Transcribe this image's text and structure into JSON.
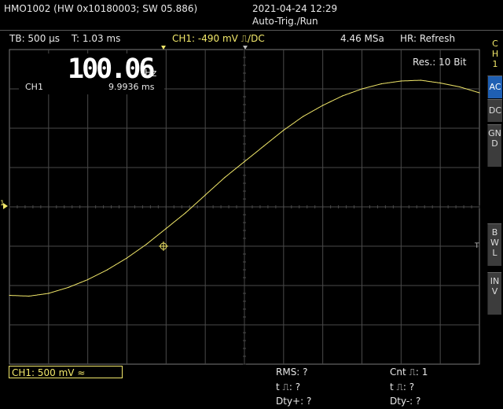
{
  "header": {
    "device": "HMO1002 (HW 0x10180003; SW 05.886)",
    "datetime": "2021-04-24 12:29",
    "mode": "Auto-Trig./Run"
  },
  "status_bar": {
    "timebase": "TB: 500 µs",
    "trigger_time": "T: 1.03 ms",
    "trigger_info": "CH1: -490 mV ⎍/DC",
    "sample_rate": "4.46 MSa",
    "hr": "HR: Refresh"
  },
  "overlay": {
    "resolution": "Res.: 10 Bit",
    "freq_value": "100.06",
    "freq_unit": "Hz",
    "channel": "CH1",
    "period": "9.9936 ms"
  },
  "side": {
    "channel_tag": [
      "C",
      "H",
      "1"
    ],
    "buttons": [
      {
        "label": "AC",
        "active": true
      },
      {
        "label": "DC",
        "active": false
      },
      {
        "label": "GND",
        "active": false
      },
      {
        "label": "BWL",
        "active": false
      },
      {
        "label": "INV",
        "active": false
      }
    ]
  },
  "markers": {
    "left": "1",
    "right": "T"
  },
  "bottom": {
    "ch1_setting": "CH1: 500 mV ≈",
    "rms": "RMS: ?",
    "pos_width": "t ⎍: ?",
    "pos_duty": "Dty+: ?",
    "count": "Cnt ⎍: 1",
    "neg_width": "t ⎍: ?",
    "neg_duty": "Dty-: ?"
  },
  "colors": {
    "trace": "#f2e86a",
    "grid": "#4a4a4a",
    "accent": "#1f5fb3"
  },
  "chart_data": {
    "type": "line",
    "x_divisions": 12,
    "y_divisions": 8,
    "series": [
      {
        "x": [
          0,
          0.5,
          1.0,
          1.5,
          2.0,
          2.5,
          3.0,
          3.5,
          4.0,
          4.5,
          5.0,
          5.5,
          6.0,
          6.5,
          7.0,
          7.5,
          8.0,
          8.5,
          9.0,
          9.5,
          10.0,
          10.5,
          11.0,
          11.5,
          12.0
        ],
        "y": [
          -2.25,
          -2.27,
          -2.2,
          -2.05,
          -1.85,
          -1.6,
          -1.3,
          -0.95,
          -0.55,
          -0.15,
          0.3,
          0.75,
          1.15,
          1.55,
          1.95,
          2.3,
          2.58,
          2.82,
          3.0,
          3.13,
          3.2,
          3.22,
          3.15,
          3.05,
          2.9
        ]
      }
    ]
  }
}
